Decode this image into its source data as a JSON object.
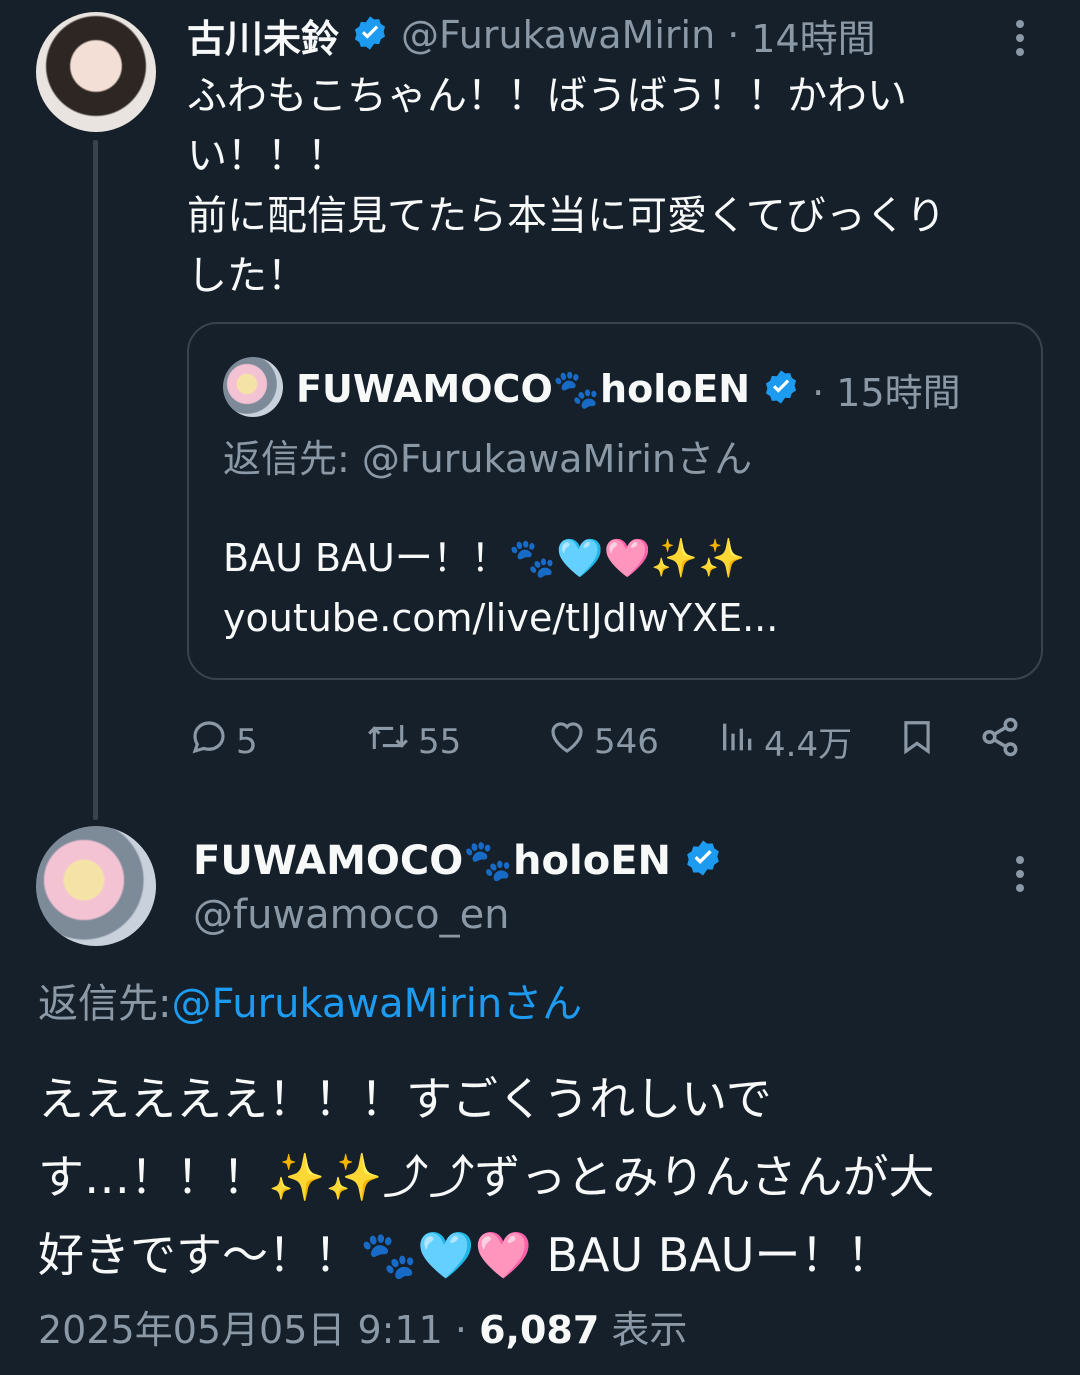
{
  "tweet1": {
    "display_name": "古川未鈴",
    "handle": "@FurukawaMirin",
    "sep": "·",
    "time": "14時間",
    "text_lines": [
      "ふわもこちゃん！！ばうばう！！かわい",
      "い！！！",
      "前に配信見てたら本当に可愛くてびっくり",
      "した！"
    ],
    "quote": {
      "display_name": "FUWAMOCO🐾holoEN",
      "time": "· 15時間",
      "reply_prefix": "返信先:",
      "reply_to": "@FurukawaMirinさん",
      "line1": "BAU BAUー！！🐾🩵🩷✨✨",
      "line2": "youtube.com/live/tIJdIwYXE..."
    },
    "actions": {
      "replies": "5",
      "retweets": "55",
      "likes": "546",
      "views": "4.4万"
    }
  },
  "tweet2": {
    "display_name": "FUWAMOCO🐾holoEN",
    "handle": "@fuwamoco_en",
    "reply_prefix": "返信先:",
    "reply_to": "@FurukawaMirinさん",
    "text_lines": [
      "えええええ！！！すごくうれしいで",
      "す…！！！✨✨⤴⤴ずっとみりんさんが大",
      "好きです〜！！🐾🩵🩷 BAU BAUー！！"
    ],
    "timestamp": "2025年05月05日 9:11",
    "dot": "·",
    "views_count": "6,087",
    "views_label": "表示"
  },
  "colors": {
    "background": "#15202b",
    "text": "#f7f9f9",
    "muted": "#8b98a5",
    "accent": "#1d9bf0",
    "border": "#38444d"
  }
}
